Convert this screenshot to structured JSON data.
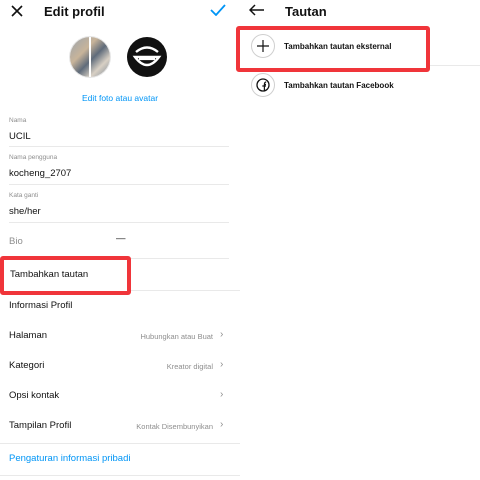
{
  "edit": {
    "title": "Edit profil",
    "change_photo": "Edit foto atau avatar",
    "fields": [
      {
        "label": "Nama",
        "value": "UCIL"
      },
      {
        "label": "Nama pengguna",
        "value": "kocheng_2707"
      },
      {
        "label": "Kata ganti",
        "value": "she/her"
      }
    ],
    "bio": {
      "label": "Bio",
      "value": "—"
    },
    "add_link": "Tambahkan tautan",
    "profile_info": "Informasi Profil",
    "rows": [
      {
        "label": "Halaman",
        "detail": "Hubungkan atau Buat"
      },
      {
        "label": "Kategori",
        "detail": "Kreator digital"
      },
      {
        "label": "Opsi kontak",
        "detail": ""
      },
      {
        "label": "Tampilan Profil",
        "detail": "Kontak Disembunyikan"
      }
    ],
    "personal_settings": "Pengaturan informasi pribadi"
  },
  "links": {
    "title": "Tautan",
    "items": [
      {
        "label": "Tambahkan tautan eksternal",
        "icon": "plus-icon"
      },
      {
        "label": "Tambahkan tautan Facebook",
        "icon": "facebook-icon"
      }
    ]
  },
  "colors": {
    "accent": "#0095f6",
    "highlight": "#f0353a"
  }
}
